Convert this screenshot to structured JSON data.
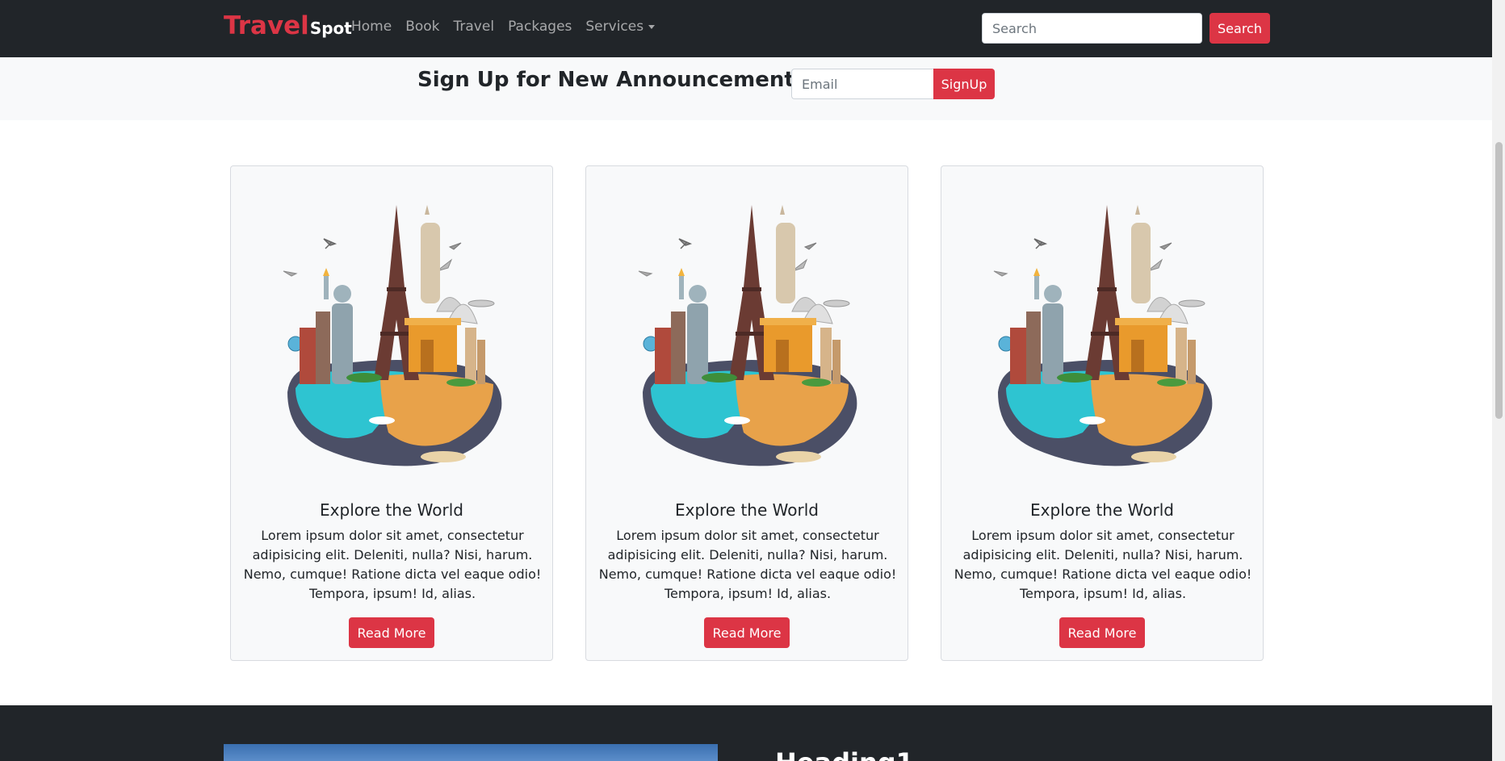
{
  "navbar": {
    "brand_main": "Travel",
    "brand_sub": "Spot",
    "links": [
      "Home",
      "Book",
      "Travel",
      "Packages",
      "Services"
    ],
    "search_placeholder": "Search",
    "search_button": "Search"
  },
  "signup": {
    "title": "Sign Up for New Announcement",
    "email_placeholder": "Email",
    "button": "SignUp"
  },
  "cards": [
    {
      "title": "Explore the World",
      "text": "Lorem ipsum dolor sit amet, consectetur adipisicing elit. Deleniti, nulla? Nisi, harum. Nemo, cumque! Ratione dicta vel eaque odio! Tempora, ipsum! Id, alias.",
      "button": "Read More"
    },
    {
      "title": "Explore the World",
      "text": "Lorem ipsum dolor sit amet, consectetur adipisicing elit. Deleniti, nulla? Nisi, harum. Nemo, cumque! Ratione dicta vel eaque odio! Tempora, ipsum! Id, alias.",
      "button": "Read More"
    },
    {
      "title": "Explore the World",
      "text": "Lorem ipsum dolor sit amet, consectetur adipisicing elit. Deleniti, nulla? Nisi, harum. Nemo, cumque! Ratione dicta vel eaque odio! Tempora, ipsum! Id, alias.",
      "button": "Read More"
    }
  ],
  "dark_section": {
    "heading": "Heading1"
  },
  "colors": {
    "brand_red": "#dc3545",
    "navbar_bg": "#212529",
    "light_bg": "#f8f9fa"
  }
}
